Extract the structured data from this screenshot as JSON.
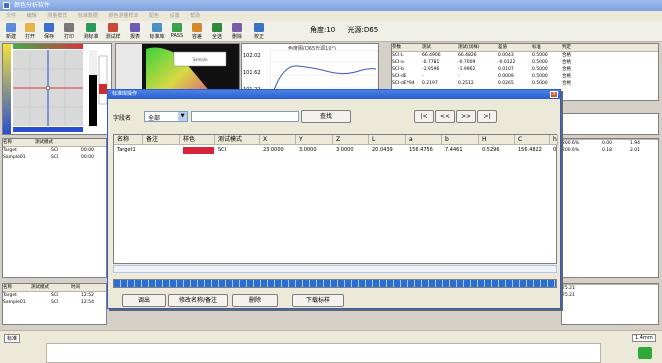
{
  "window": {
    "title": "颜色分析软件"
  },
  "menu": [
    "文件",
    "编辑",
    "测量模式",
    "标准数据",
    "颜色测量样本",
    "配色",
    "设置",
    "帮助"
  ],
  "toolbar": [
    {
      "label": "新建",
      "icon": "new-file-icon",
      "color": "#5b8bd9"
    },
    {
      "label": "打开",
      "icon": "open-folder-icon",
      "color": "#e2b44a"
    },
    {
      "label": "保存",
      "icon": "save-icon",
      "color": "#3d6fc8"
    },
    {
      "label": "打印",
      "icon": "print-icon",
      "color": "#7a7a7a"
    },
    {
      "label": "测标准",
      "icon": "measure-standard-icon",
      "color": "#2d9c5a"
    },
    {
      "label": "测试样",
      "icon": "measure-sample-icon",
      "color": "#c74d3a"
    },
    {
      "label": "报表",
      "icon": "report-icon",
      "color": "#6f5bb5"
    },
    {
      "label": "标准库",
      "icon": "standard-library-icon",
      "color": "#4a90c2"
    },
    {
      "label": "PASS",
      "icon": "pass-icon",
      "color": "#3aa04a"
    },
    {
      "label": "容差",
      "icon": "tolerance-icon",
      "color": "#d48a2a"
    },
    {
      "label": "全选",
      "icon": "select-all-icon",
      "color": "#2f8a3e"
    },
    {
      "label": "删除",
      "icon": "delete-icon",
      "color": "#7b5ea8"
    },
    {
      "label": "校正",
      "icon": "calibrate-icon",
      "color": "#3a74c4"
    }
  ],
  "angle": {
    "observer": "角度:10",
    "illuminant": "光源:D65"
  },
  "chart_panel_title": "色度图(D65光源10°)",
  "spectral_ticks": [
    "102.02",
    "101.62",
    "101.22"
  ],
  "right_table": {
    "headers": [
      "参数",
      "测试",
      "测试(试样)",
      "差值",
      "标准",
      "判定"
    ],
    "rows": [
      [
        "SCI-L",
        "66.4906",
        "66.4826",
        "0.0043",
        "0.5000",
        "合格"
      ],
      [
        "SCI-a",
        "-0.7781",
        "-0.7009",
        "-0.0122",
        "0.5000",
        "合格"
      ],
      [
        "SCI-b",
        "-1.9596",
        "-1.9962",
        "0.0107",
        "0.5000",
        "合格"
      ],
      [
        "SCI-dE",
        "-",
        "-",
        "0.0009",
        "0.5000",
        "合格"
      ],
      [
        "SCI-dE*94",
        "0.2197",
        "0.2512",
        "0.0265",
        "0.5000",
        "合格"
      ]
    ]
  },
  "std_table": {
    "headers": [
      "名称",
      "测试模式",
      "",
      ""
    ],
    "rows": [
      [
        "Target",
        "SCI",
        "00:00"
      ],
      [
        "Sample01",
        "SCI",
        "00:00"
      ]
    ]
  },
  "bottom_table": {
    "headers": [
      "名称",
      "测试模式",
      "时间"
    ],
    "rows": [
      [
        "Target",
        "SCI",
        "12:52"
      ],
      [
        "Sample01",
        "SCI",
        "12:54"
      ]
    ]
  },
  "right_mini": {
    "col_a": [
      "200.6%",
      "200.6%"
    ],
    "col_b": [
      "0.00",
      "0.18"
    ],
    "col_c": [
      "1.94",
      "2.01"
    ]
  },
  "right_lower": [
    "75.21",
    "75.21"
  ],
  "status": {
    "left": "标准",
    "right": "1.4mm"
  },
  "dialog": {
    "title": "标准库操作",
    "field_label": "字段名",
    "field_value": "全部",
    "search_value": "",
    "search_button": "查找",
    "nav": [
      "|<",
      "<<",
      ">>",
      ">|"
    ],
    "columns": [
      "名称",
      "备注",
      "样色",
      "测试模式",
      "X",
      "Y",
      "Z",
      "L",
      "a",
      "b",
      "H",
      "C",
      "h"
    ],
    "row": {
      "name": "Target1",
      "note": "",
      "swatch": "#d8243b",
      "mode": "SCI",
      "X": "23.0000",
      "Y": "3.0000",
      "Z": "3.0000",
      "L": "20.0439",
      "a": "156.4756",
      "b": "7.4461",
      "H": "0.5296",
      "C": "156.4822",
      "h": "0"
    },
    "progress": 1.0,
    "buttons": [
      "调出",
      "修改名称/备注",
      "删除",
      "下载标样"
    ]
  }
}
